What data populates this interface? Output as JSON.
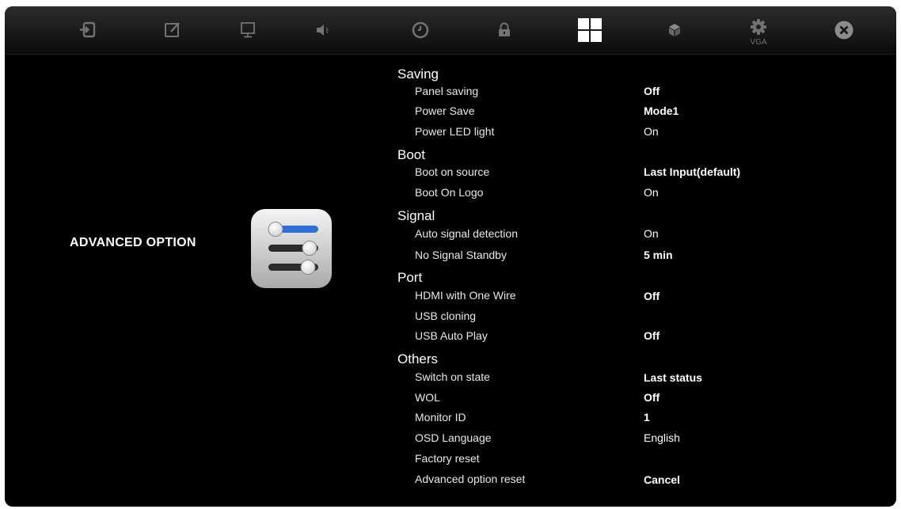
{
  "menu": {
    "icons": [
      "input-source-icon",
      "edit-icon",
      "monitor-icon",
      "volume-icon",
      "clock-icon",
      "lock-icon",
      "advanced-option-icon",
      "cube-icon",
      "settings-icon",
      "close-icon"
    ],
    "source_label": "VGA",
    "active_tab": "advanced-option"
  },
  "page": {
    "title": "ADVANCED OPTION"
  },
  "sections": {
    "saving": {
      "heading": "Saving",
      "panel_saving": {
        "label": "Panel saving",
        "value": "Off"
      },
      "power_save": {
        "label": "Power Save",
        "value": "Mode1"
      },
      "power_led_light": {
        "label": "Power LED light",
        "value": "On"
      }
    },
    "boot": {
      "heading": "Boot",
      "boot_on_source": {
        "label": "Boot on source",
        "value": "Last Input(default)"
      },
      "boot_on_logo": {
        "label": "Boot On Logo",
        "value": "On"
      }
    },
    "signal": {
      "heading": "Signal",
      "auto_signal_detection": {
        "label": "Auto signal detection",
        "value": "On"
      },
      "no_signal_standby": {
        "label": "No Signal Standby",
        "value": "5 min"
      }
    },
    "port": {
      "heading": "Port",
      "hdmi_one_wire": {
        "label": "HDMI with One Wire",
        "value": "Off"
      },
      "usb_cloning": {
        "label": "USB cloning"
      },
      "usb_auto_play": {
        "label": "USB Auto Play",
        "value": "Off"
      }
    },
    "others": {
      "heading": "Others",
      "switch_on_state": {
        "label": "Switch on state",
        "value": "Last status"
      },
      "wol": {
        "label": "WOL",
        "value": "Off"
      },
      "monitor_id": {
        "label": "Monitor ID",
        "value": "1"
      },
      "osd_language": {
        "label": "OSD Language",
        "value": "English"
      },
      "factory_reset": {
        "label": "Factory reset"
      },
      "advanced_option_reset": {
        "label": "Advanced option reset",
        "value": "Cancel"
      }
    }
  },
  "colors": {
    "background": "#000000",
    "text": "#ffffff",
    "icon_inactive": "#707070",
    "icon_active": "#ffffff",
    "slider_accent": "#2f6fd6"
  }
}
